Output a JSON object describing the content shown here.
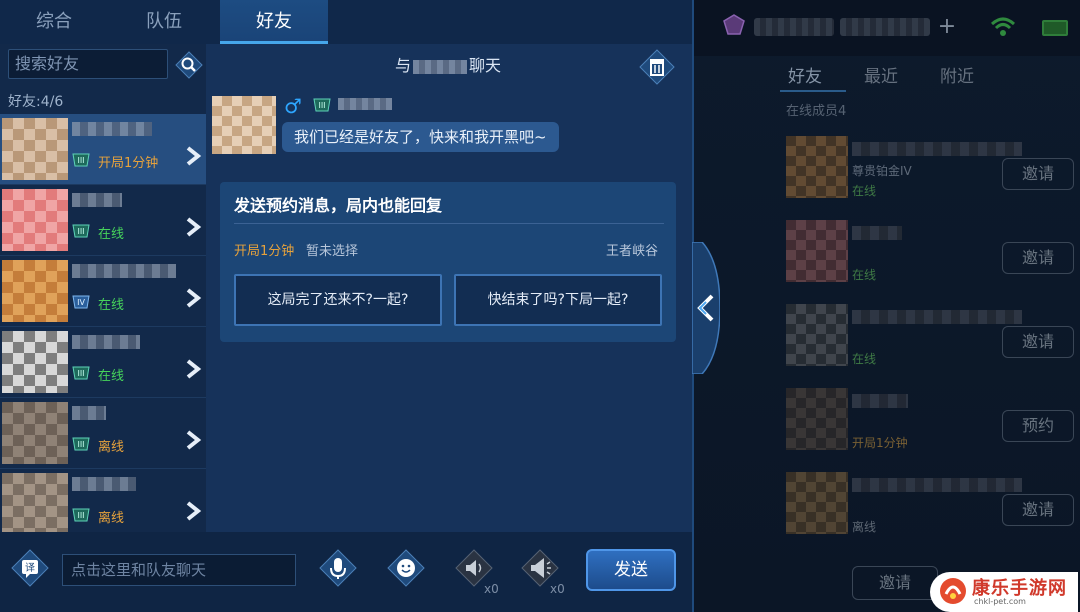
{
  "tabs": {
    "general": "综合",
    "team": "队伍",
    "friends": "好友"
  },
  "sidebar": {
    "search_placeholder": "搜索好友",
    "friend_count": "好友:4/6",
    "friends": [
      {
        "status": "开局1分钟",
        "status_color": "#e6a23c",
        "avatar_a": "#d9bfa6",
        "avatar_b": "#b99878"
      },
      {
        "status": "在线",
        "status_color": "#46d35b",
        "avatar_a": "#f0a5a5",
        "avatar_b": "#e27b7b"
      },
      {
        "status": "在线",
        "status_color": "#46d35b",
        "avatar_a": "#e0a25a",
        "avatar_b": "#c47d3a"
      },
      {
        "status": "在线",
        "status_color": "#46d35b",
        "avatar_a": "#d8d8d8",
        "avatar_b": "#7e7e7e"
      },
      {
        "status": "离线",
        "status_color": "#e6a23c",
        "avatar_a": "#8f8276",
        "avatar_b": "#6d6157"
      },
      {
        "status": "离线",
        "status_color": "#e6a23c",
        "avatar_a": "#a39485",
        "avatar_b": "#7b6e62"
      }
    ]
  },
  "chat": {
    "title_prefix": "与",
    "title_suffix": "聊天",
    "message": "我们已经是好友了，快来和我开黑吧~",
    "appointment": {
      "title": "发送预约消息，局内也能回复",
      "time": "开局1分钟",
      "choice": "暂未选择",
      "mode": "王者峡谷",
      "quick_replies": [
        "这局完了还来不?一起?",
        "快结束了吗?下局一起?"
      ]
    }
  },
  "bottom": {
    "input_placeholder": "点击这里和队友聊天",
    "speaker_count_1": "x0",
    "speaker_count_2": "x0",
    "send": "发送"
  },
  "right_panel": {
    "tabs": [
      "好友",
      "最近",
      "附近"
    ],
    "online_members": "在线成员4",
    "rank": "尊贵铂金IV",
    "rows": [
      {
        "status": "在线",
        "status_color": "#3f7a45",
        "button": "邀请"
      },
      {
        "status": "在线",
        "status_color": "#3f7a45",
        "button": "邀请"
      },
      {
        "status": "在线",
        "status_color": "#3f7a45",
        "button": "邀请"
      },
      {
        "status": "开局1分钟",
        "status_color": "#7a6033",
        "button": "预约"
      },
      {
        "status": "离线",
        "status_color": "#5d6773",
        "button": "邀请"
      }
    ],
    "bottom_invite": "邀请"
  },
  "watermark": {
    "title": "康乐手游网",
    "url": "chkl-pet.com"
  }
}
